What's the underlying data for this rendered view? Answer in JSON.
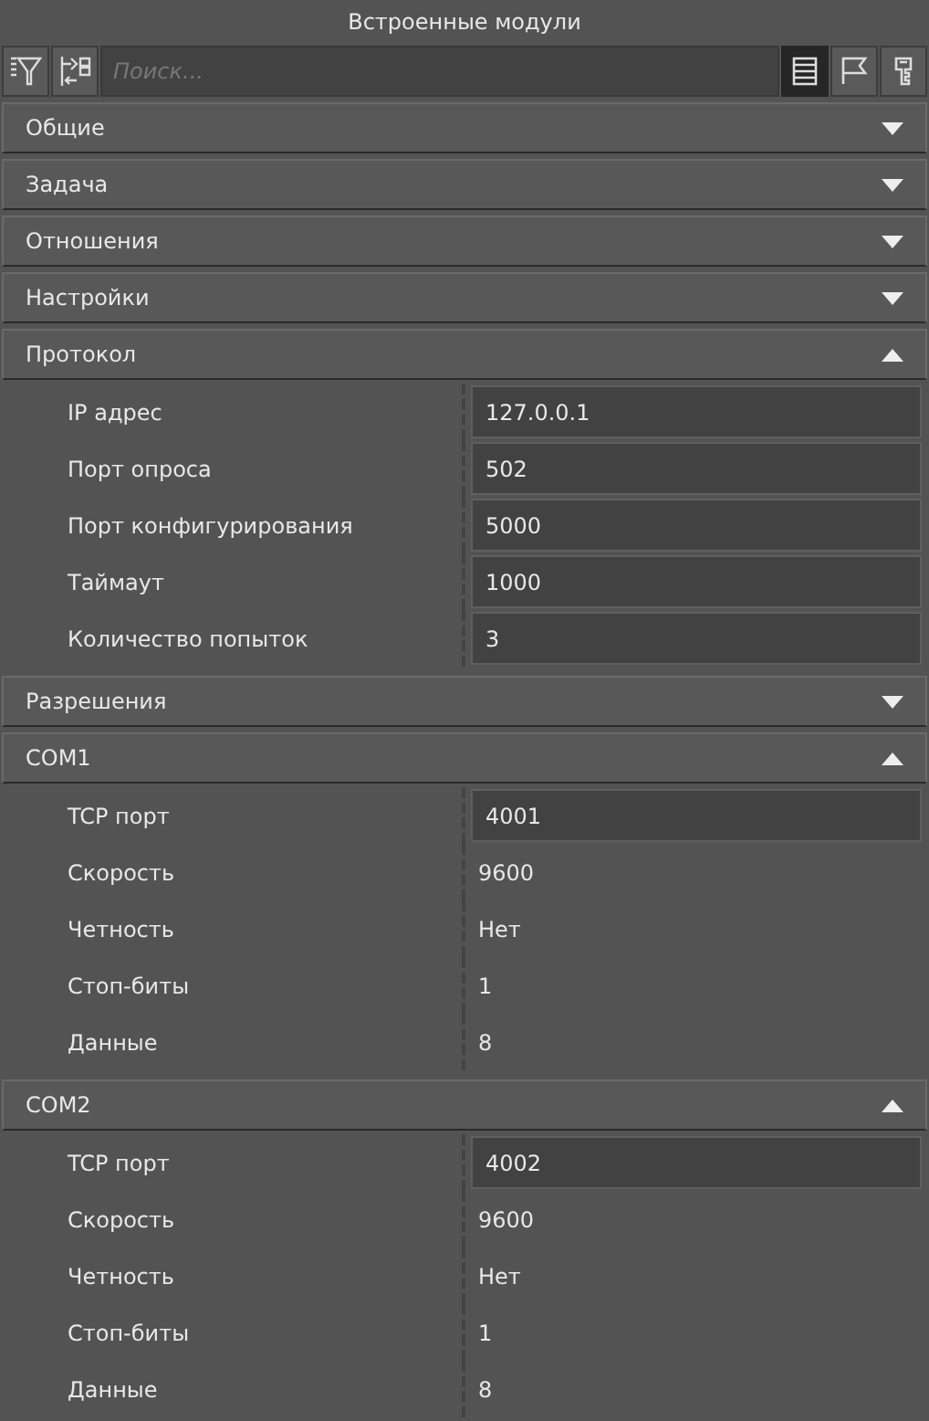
{
  "window": {
    "title": "Встроенные модули"
  },
  "toolbar": {
    "search": {
      "placeholder": "Поиск..."
    },
    "view_buttons": [
      {
        "kind": "list",
        "selected": true
      },
      {
        "kind": "flag",
        "selected": false
      },
      {
        "kind": "key",
        "selected": false
      }
    ]
  },
  "sections": [
    {
      "title": "Общие",
      "expanded": false
    },
    {
      "title": "Задача",
      "expanded": false
    },
    {
      "title": "Отношения",
      "expanded": false
    },
    {
      "title": "Настройки",
      "expanded": false
    },
    {
      "title": "Протокол",
      "expanded": true,
      "properties": [
        {
          "label": "IP адрес",
          "value": "127.0.0.1",
          "kind": "field"
        },
        {
          "label": "Порт опроса",
          "value": "502",
          "kind": "field"
        },
        {
          "label": "Порт конфигурирования",
          "value": "5000",
          "kind": "field"
        },
        {
          "label": "Таймаут",
          "value": "1000",
          "kind": "field"
        },
        {
          "label": "Количество попыток",
          "value": "3",
          "kind": "field"
        }
      ]
    },
    {
      "title": "Разрешения",
      "expanded": false
    },
    {
      "title": "COM1",
      "expanded": true,
      "properties": [
        {
          "label": "TCP порт",
          "value": "4001",
          "kind": "field"
        },
        {
          "label": "Скорость",
          "value": "9600",
          "kind": "text"
        },
        {
          "label": "Четность",
          "value": "Нет",
          "kind": "text"
        },
        {
          "label": "Стоп-биты",
          "value": "1",
          "kind": "text"
        },
        {
          "label": "Данные",
          "value": "8",
          "kind": "text"
        }
      ]
    },
    {
      "title": "COM2",
      "expanded": true,
      "properties": [
        {
          "label": "TCP порт",
          "value": "4002",
          "kind": "field"
        },
        {
          "label": "Скорость",
          "value": "9600",
          "kind": "text"
        },
        {
          "label": "Четность",
          "value": "Нет",
          "kind": "text"
        },
        {
          "label": "Стоп-биты",
          "value": "1",
          "kind": "text"
        },
        {
          "label": "Данные",
          "value": "8",
          "kind": "text"
        }
      ]
    }
  ]
}
